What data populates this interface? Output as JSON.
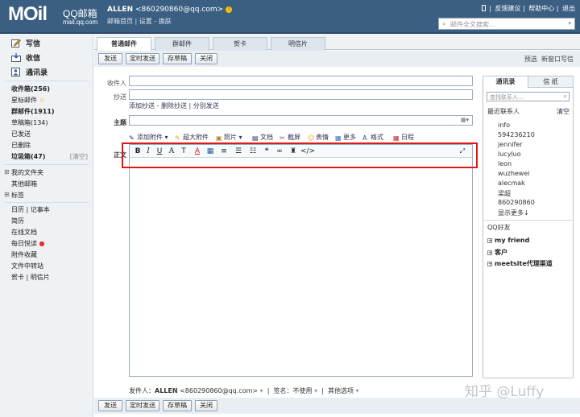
{
  "header": {
    "logo_main": "MOil",
    "logo_cn": "QQ邮箱",
    "logo_domain": "mail.qq.com",
    "user_name": "ALLEN",
    "user_email": "<860290860@qq.com>",
    "user_links": [
      "邮箱首页",
      "设置",
      "换肤"
    ],
    "top_links": [
      "反馈建议",
      "帮助中心",
      "退出"
    ],
    "search_placeholder": "邮件全文搜索..."
  },
  "sidebar": {
    "primary": [
      "写信",
      "收信",
      "通讯录"
    ],
    "folders": [
      {
        "label": "收件箱(256)",
        "bold": true
      },
      {
        "label": "星标邮件",
        "bold": false
      },
      {
        "label": "群邮件(1911)",
        "bold": true
      },
      {
        "label": "草稿箱(134)",
        "bold": false
      },
      {
        "label": "已发送",
        "bold": false
      },
      {
        "label": "已删除",
        "bold": false
      },
      {
        "label": "垃圾箱(47)",
        "bold": true
      }
    ],
    "clear_label": "[清空]",
    "groups": [
      "我的文件夹",
      "其他邮箱",
      "标签"
    ],
    "apps": [
      "日历",
      "记事本",
      "简历",
      "在线文档",
      "每日悦读",
      "附件收藏",
      "文件中转站",
      "贺卡",
      "明信片"
    ]
  },
  "compose": {
    "tabs": [
      "普通邮件",
      "群邮件",
      "贺卡",
      "明信片"
    ],
    "buttons": [
      "发送",
      "定时发送",
      "存草稿",
      "关闭"
    ],
    "right_links": [
      "预选",
      "新窗口写信"
    ],
    "labels": {
      "to": "收件人",
      "cc": "抄送",
      "subject": "主题",
      "body": "正文"
    },
    "sub_links": [
      "添加抄送",
      "删除抄送",
      "分别发送"
    ],
    "attach_tools": [
      "添加附件",
      "超大附件",
      "照片",
      "文档",
      "截屏",
      "表情",
      "更多",
      "格式",
      "日程"
    ],
    "format_tools": [
      "B",
      "I",
      "U",
      "A",
      "T",
      "A",
      "▦",
      "≡",
      "☰",
      "☷",
      "❝",
      "∞",
      "♜",
      "</>"
    ],
    "bottom": {
      "sender_label": "发件人：",
      "sender_name": "ALLEN",
      "sender_email": "<860290860@qq.com>",
      "signature": "签名：不使用",
      "options": "其他选项"
    }
  },
  "contacts_panel": {
    "tabs": [
      "通讯录",
      "信 纸"
    ],
    "search_placeholder": "查找联系人...",
    "recent_title": "最近联系人",
    "clear": "清空",
    "recent": [
      "info",
      "594236210",
      "jennifer",
      "lucyluo",
      "leon",
      "wuzhewei",
      "alecmak",
      "梁超",
      "860290860",
      "显示更多↓"
    ],
    "qq_title": "QQ好友",
    "groups": [
      "my friend",
      "客户",
      "meetsite代理渠道"
    ]
  },
  "watermark": "知乎 @Luffy"
}
